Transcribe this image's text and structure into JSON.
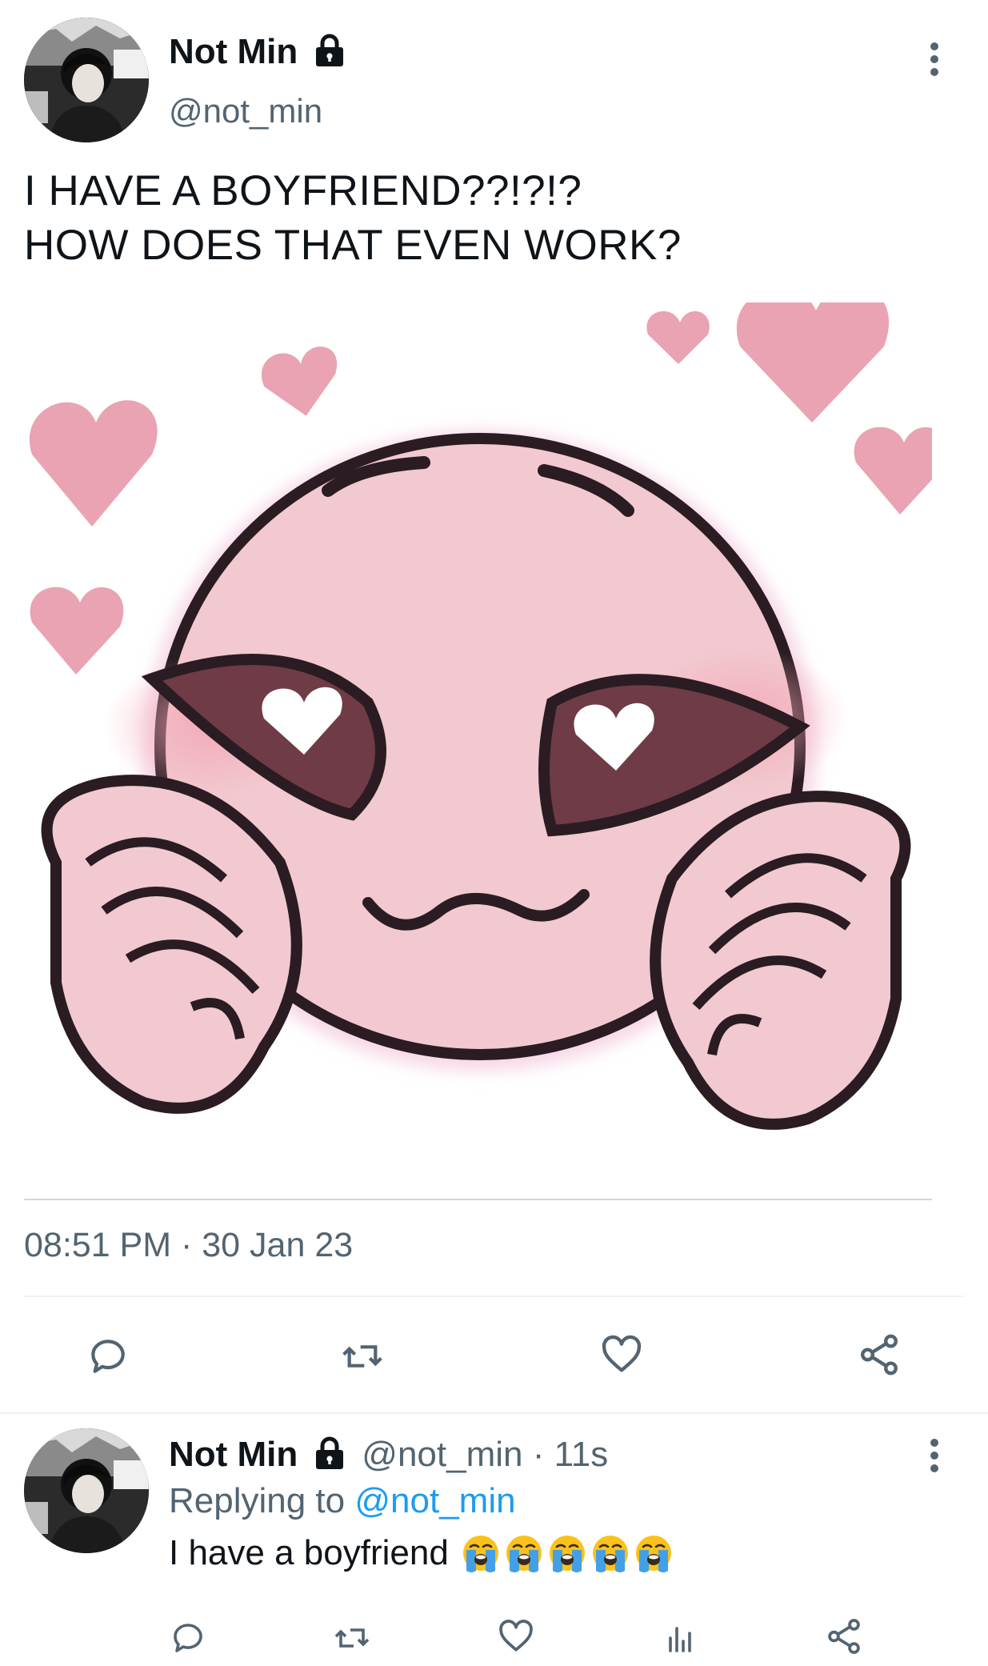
{
  "tweet": {
    "author": {
      "name": "Not Min",
      "handle": "@not_min",
      "avatar_icon": "profile-photo",
      "locked_icon": "lock-icon"
    },
    "text_lines": [
      "I HAVE A BOYFRIEND??!?!?",
      "HOW DOES THAT EVEN WORK?"
    ],
    "image_alt_icon": "blushing-emoji-sticker",
    "timestamp": "08:51 PM · 30 Jan 23",
    "actions": [
      "reply-icon",
      "retweet-icon",
      "like-icon",
      "share-icon"
    ]
  },
  "reply": {
    "author": {
      "name": "Not Min",
      "handle": "@not_min · 11s"
    },
    "replying_prefix": "Replying to",
    "replying_to": "@not_min",
    "text": "I have a boyfriend",
    "emoji_count": 5,
    "emoji_icon": "loudly-crying-face",
    "actions": [
      "reply-icon",
      "retweet-icon",
      "like-icon",
      "analytics-icon",
      "share-icon"
    ]
  },
  "colors": {
    "text": "#0f1419",
    "secondary": "#536471",
    "link": "#1d9bf0",
    "icon": "#536471",
    "divider": "#eff3f4",
    "sticker_pink": "#f2c9d0",
    "heart_pink": "#e9a3b3"
  }
}
